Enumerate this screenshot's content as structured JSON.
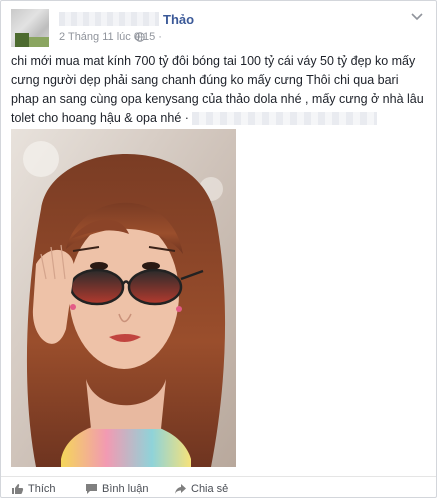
{
  "post": {
    "author_name": "Thảo",
    "timestamp": "2 Tháng 11 lúc 0:15 ·",
    "text": "chi mới mua mat kính 700 tỷ đôi bóng tai 100 tỷ cái váy 50 tỷ đẹp ko mấy cưng người dẹp phải sang chanh đúng ko mấy cưng Thôi chi qua bari phap an sang cùng opa kenysang của thảo dola nhé , mấy cưng ở nhà lâu tolet cho hoang hậu & opa nhé ·"
  },
  "actions": {
    "like_label": "Thích",
    "comment_label": "Bình luận",
    "share_label": "Chia sẻ"
  },
  "colors": {
    "name": "#3b5998",
    "meta": "#90949c",
    "text": "#1d2129",
    "action": "#4b4f56"
  }
}
